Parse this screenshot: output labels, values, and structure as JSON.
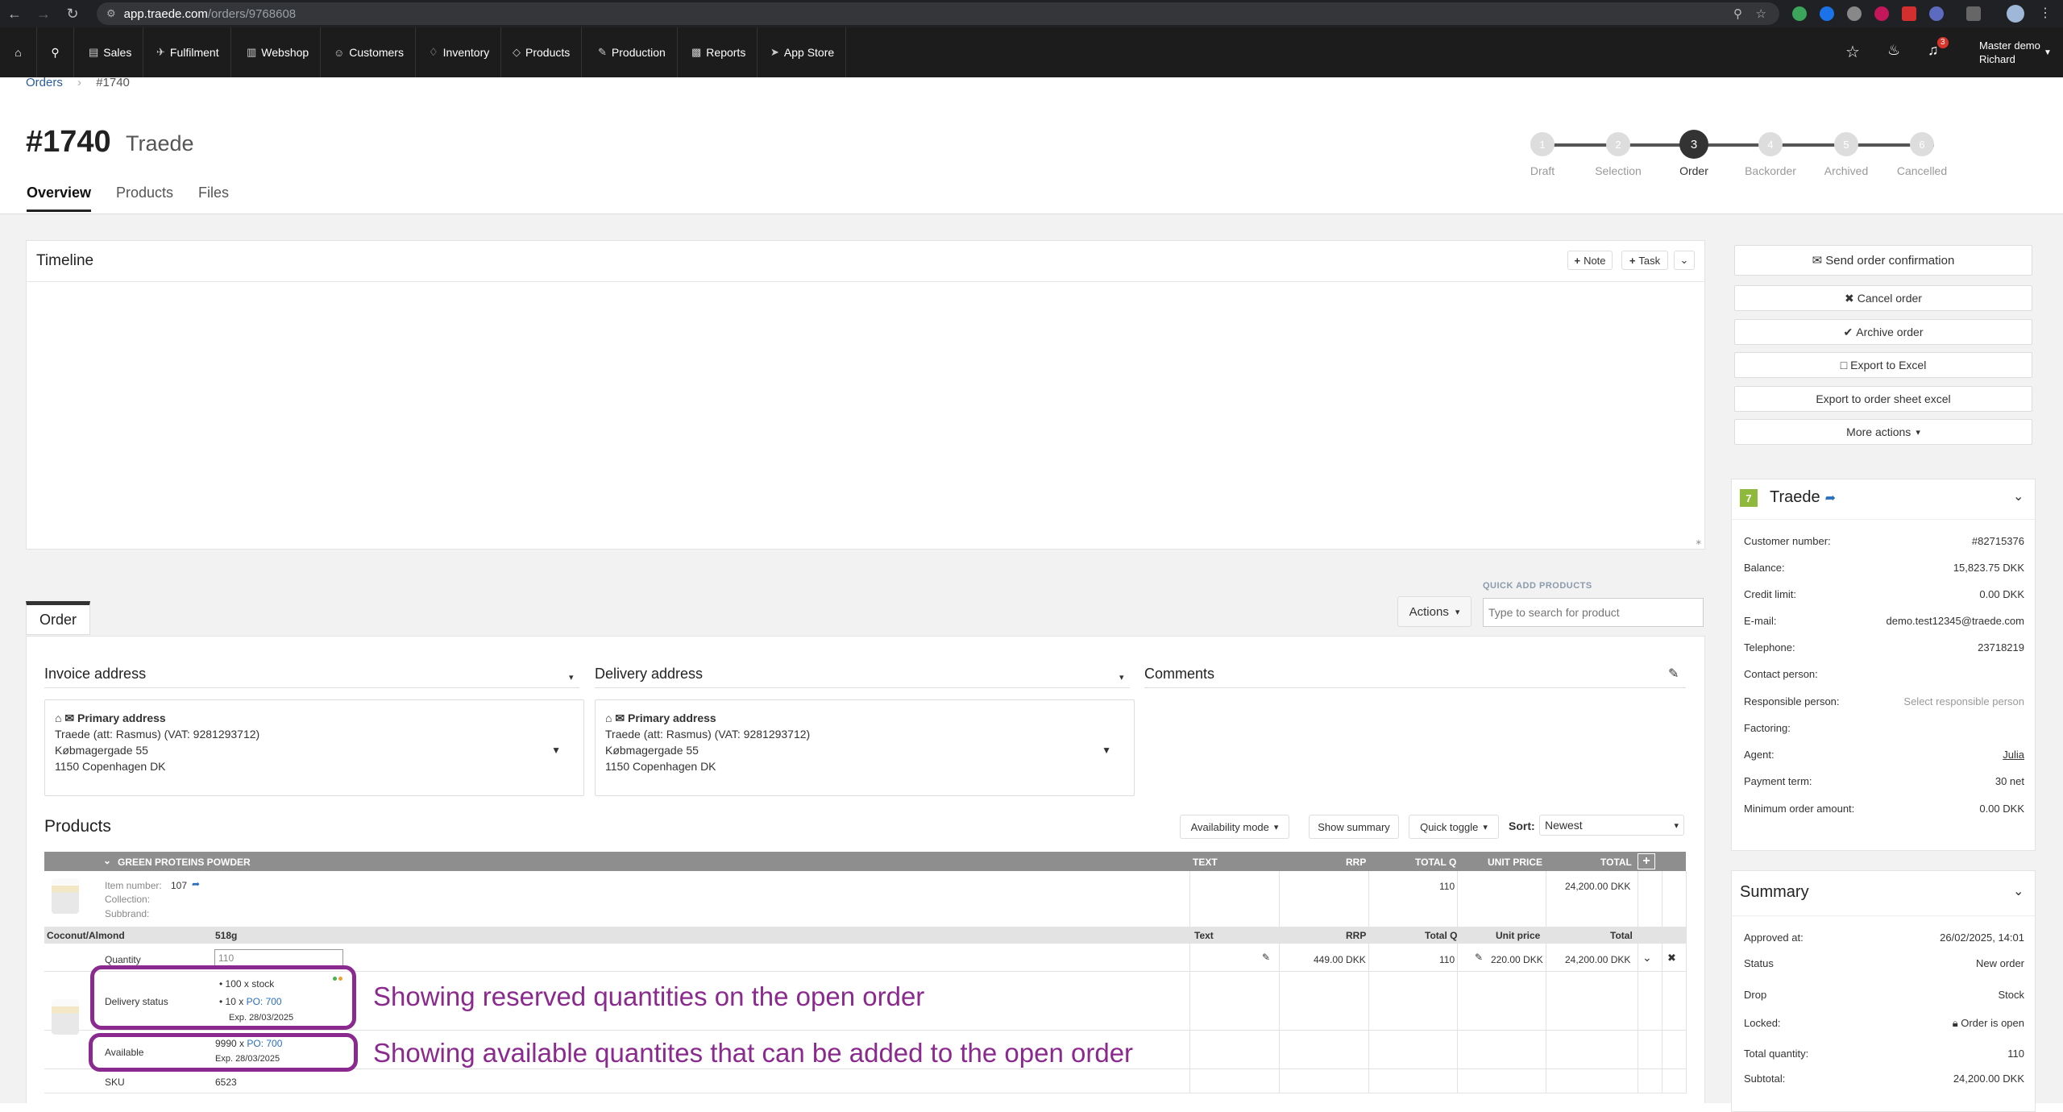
{
  "browser": {
    "url_domain": "app.traede.com",
    "url_path": "/orders/9768608"
  },
  "nav": {
    "items": [
      "Sales",
      "Fulfilment",
      "Webshop",
      "Customers",
      "Inventory",
      "Products",
      "Production",
      "Reports",
      "App Store"
    ],
    "user_line1": "Master demo",
    "user_line2": "Richard",
    "notif_count": "3"
  },
  "breadcrumb": {
    "parent": "Orders",
    "current": "#1740"
  },
  "header": {
    "order_no": "#1740",
    "company": "Traede"
  },
  "tabs": [
    "Overview",
    "Products",
    "Files"
  ],
  "steps": [
    {
      "n": "1",
      "label": "Draft"
    },
    {
      "n": "2",
      "label": "Selection"
    },
    {
      "n": "3",
      "label": "Order"
    },
    {
      "n": "4",
      "label": "Backorder"
    },
    {
      "n": "5",
      "label": "Archived"
    },
    {
      "n": "6",
      "label": "Cancelled"
    }
  ],
  "timeline": {
    "title": "Timeline",
    "note": "Note",
    "task": "Task"
  },
  "actions": {
    "send": "Send order confirmation",
    "cancel": "Cancel order",
    "archive": "Archive order",
    "excel": "Export to Excel",
    "sheet": "Export to order sheet excel",
    "more": "More actions"
  },
  "customer": {
    "badge": "7",
    "name": "Traede",
    "rows": [
      {
        "k": "Customer number:",
        "v": "#82715376"
      },
      {
        "k": "Balance:",
        "v": "15,823.75 DKK"
      },
      {
        "k": "Credit limit:",
        "v": "0.00 DKK"
      },
      {
        "k": "E-mail:",
        "v": "demo.test12345@traede.com"
      },
      {
        "k": "Telephone:",
        "v": "23718219"
      },
      {
        "k": "Contact person:",
        "v": ""
      },
      {
        "k": "Responsible person:",
        "v": "Select responsible person"
      },
      {
        "k": "Factoring:",
        "v": ""
      },
      {
        "k": "Agent:",
        "v": "Julia"
      },
      {
        "k": "Payment term:",
        "v": "30 net"
      },
      {
        "k": "Minimum order amount:",
        "v": "0.00 DKK"
      }
    ]
  },
  "summary": {
    "title": "Summary",
    "rows": [
      {
        "k": "Approved at:",
        "v": "26/02/2025, 14:01"
      },
      {
        "k": "Status",
        "v": "New order"
      },
      {
        "k": "Drop",
        "v": "Stock"
      },
      {
        "k": "Locked:",
        "v": "Order is open"
      },
      {
        "k": "Total quantity:",
        "v": "110"
      },
      {
        "k": "Subtotal:",
        "v": "24,200.00 DKK"
      }
    ]
  },
  "order": {
    "tab": "Order",
    "actions": "Actions",
    "quick_add_label": "QUICK ADD PRODUCTS",
    "quick_add_placeholder": "Type to search for product"
  },
  "invoice": {
    "title": "Invoice address",
    "head": "Primary address",
    "l1": "Traede (att: Rasmus) (VAT: 9281293712)",
    "l2": "Købmagergade 55",
    "l3": "1150 Copenhagen DK"
  },
  "delivery": {
    "title": "Delivery address",
    "head": "Primary address",
    "l1": "Traede (att: Rasmus) (VAT: 9281293712)",
    "l2": "Købmagergade 55",
    "l3": "1150 Copenhagen DK"
  },
  "comments": {
    "title": "Comments"
  },
  "products": {
    "title": "Products",
    "availability": "Availability mode",
    "show_summary": "Show summary",
    "quick_toggle": "Quick toggle",
    "sort_label": "Sort:",
    "sort_value": "Newest",
    "header": {
      "name": "GREEN PROTEINS POWDER",
      "text": "TEXT",
      "rrp": "RRP",
      "totalq": "TOTAL Q",
      "unit": "UNIT PRICE",
      "total": "TOTAL"
    },
    "item_number_label": "Item number:",
    "item_number": "107",
    "collection_label": "Collection:",
    "subbrand_label": "Subbrand:",
    "row_totalq": "110",
    "row_total": "24,200.00 DKK",
    "variant": {
      "name": "Coconut/Almond",
      "size": "518g",
      "text": "Text",
      "rrp": "RRP",
      "totalq": "Total Q",
      "unit": "Unit price",
      "total": "Total"
    },
    "quantity_label": "Quantity",
    "quantity": "110",
    "rrp_val": "449.00 DKK",
    "totalq_val": "110",
    "unit_val": "220.00 DKK",
    "total_val": "24,200.00 DKK",
    "delivery_status_label": "Delivery status",
    "ds1": "100 x stock",
    "ds2_pre": "10 x",
    "ds2_po": "PO: 700",
    "ds2_exp": "Exp. 28/03/2025",
    "available_label": "Available",
    "av_pre": "9990 x",
    "av_po": "PO: 700",
    "av_exp": "Exp. 28/03/2025",
    "sku_label": "SKU",
    "sku": "6523"
  },
  "annotations": {
    "a1": "Showing reserved quantities on the open order",
    "a2": "Showing available quantites that can be added to the open order"
  }
}
